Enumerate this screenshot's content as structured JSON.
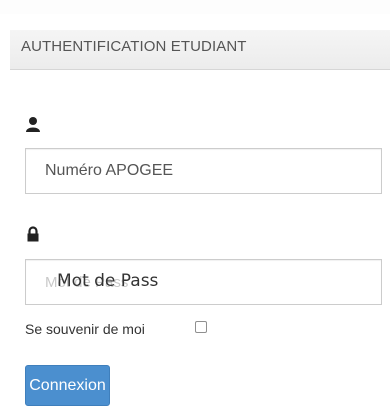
{
  "panel": {
    "title": "AUTHENTIFICATION ETUDIANT"
  },
  "form": {
    "apogee_value": "Numéro APOGEE",
    "password_placeholder": "Mot de Pass",
    "password_value": "Mot de Pass",
    "remember_label": "Se souvenir de moi",
    "remember_checked": false,
    "submit_label": "Connexion"
  },
  "icons": {
    "user": "user-icon",
    "lock": "lock-icon"
  },
  "colors": {
    "primary": "#4b8fcf",
    "text": "#555555",
    "border": "#cccccc"
  }
}
